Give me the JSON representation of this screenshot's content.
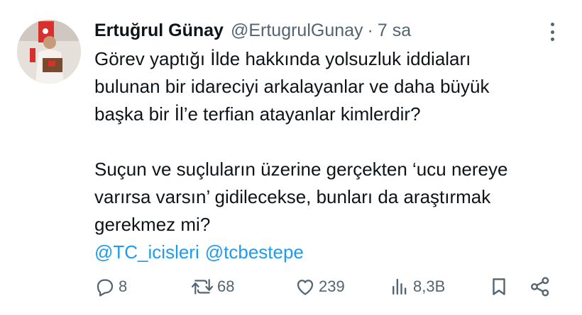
{
  "author": {
    "name": "Ertuğrul Günay",
    "handle": "@ErtugrulGunay",
    "separator": "·",
    "time": "7 sa"
  },
  "tweet": {
    "lines": [
      "Görev yaptığı İlde hakkında yolsuzluk iddiaları",
      "bulunan bir idareciyi arkalayanlar ve daha büyük",
      "başka bir İl’e terfian atayanlar kimlerdir?"
    ],
    "lines2": [
      "Suçun ve suçluların üzerine gerçekten ‘ucu nereye",
      "varırsa varsın’ gidilecekse, bunları da araştırmak",
      "gerekmez  mi?"
    ],
    "mentions": [
      "@TC_icisleri",
      "@tcbestepe"
    ]
  },
  "actions": {
    "reply_count": "8",
    "retweet_count": "68",
    "like_count": "239",
    "views_count": "8,3B"
  },
  "icons": {
    "avatar": "avatar-photo",
    "more": "more-vertical-icon",
    "reply": "reply-icon",
    "retweet": "retweet-icon",
    "like": "heart-icon",
    "views": "views-icon",
    "bookmark": "bookmark-icon",
    "share": "share-icon"
  },
  "colors": {
    "text": "#0f1419",
    "secondary": "#536471",
    "link": "#1d9bf0"
  }
}
